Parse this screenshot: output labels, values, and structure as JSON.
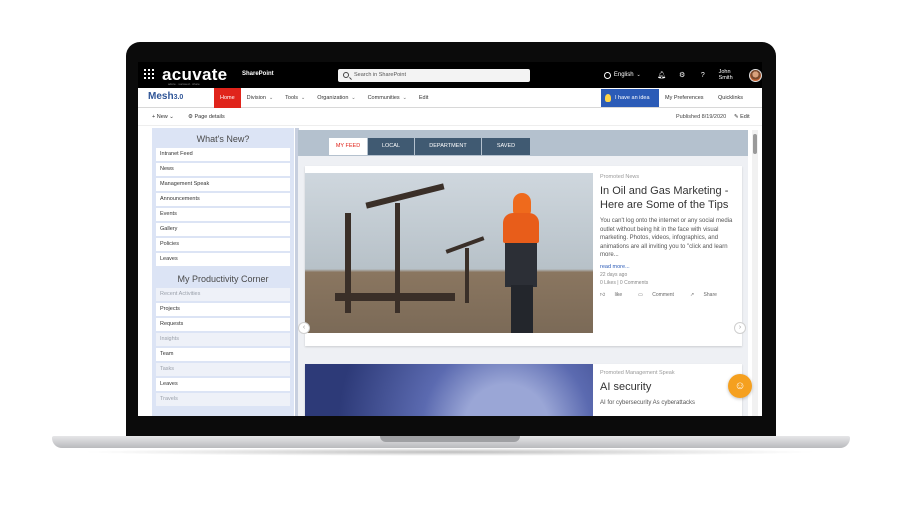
{
  "suitebar": {
    "logo": "acuvate",
    "logo_tag": "adore · succeed · share",
    "app_name": "SharePoint",
    "search_placeholder": "Search in SharePoint",
    "language": "English",
    "user_name": "John Smith"
  },
  "nav": {
    "logo": "Mesh",
    "logo_version": "3.0",
    "items": [
      {
        "label": "Home"
      },
      {
        "label": "Division"
      },
      {
        "label": "Tools"
      },
      {
        "label": "Organization"
      },
      {
        "label": "Communities"
      },
      {
        "label": "Edit"
      }
    ],
    "idea_button": "I have an idea",
    "preferences": "My Preferences",
    "quicklinks": "Quicklinks"
  },
  "commandbar": {
    "new": "New",
    "page_details": "Page details",
    "published": "Published 8/19/2020",
    "edit": "Edit"
  },
  "leftrail": {
    "whats_new_title": "What's New?",
    "whats_new_items": [
      "Intranet Feed",
      "News",
      "Management Speak",
      "Announcements",
      "Events",
      "Gallery",
      "Policies",
      "Leaves"
    ],
    "productivity_title": "My Productivity Corner",
    "productivity_items": [
      {
        "label": "Recent Activities",
        "muted": true
      },
      {
        "label": "Projects",
        "muted": false
      },
      {
        "label": "Requests",
        "muted": false
      },
      {
        "label": "Insights",
        "muted": true
      },
      {
        "label": "Team",
        "muted": false
      },
      {
        "label": "Tasks",
        "muted": true
      },
      {
        "label": "Leaves",
        "muted": false
      },
      {
        "label": "Travels",
        "muted": true
      }
    ]
  },
  "feed": {
    "tabs": [
      "MY FEED",
      "LOCAL",
      "DEPARTMENT",
      "SAVED"
    ],
    "card1": {
      "category": "Promoted News",
      "headline": "In Oil and Gas Marketing - Here are Some of the Tips",
      "excerpt": "You can't log onto the internet or any social media outlet without being hit in the face with visual marketing. Photos, videos, infographics, and animations are all inviting you to \"click and learn more...",
      "read_more": "read more...",
      "date": "22 days ago",
      "counts": "0 Likes | 0 Comments",
      "like": "like",
      "comment": "Comment",
      "share": "Share"
    },
    "card2": {
      "category": "Promoted Management Speak",
      "headline": "AI security",
      "excerpt": "AI for cybersecurity As cyberattacks"
    }
  },
  "colors": {
    "accent": "#e0241b",
    "brand_blue": "#2b5bb7",
    "rail_bg": "#dce4f5",
    "tab_bg": "#405a72",
    "fab": "#f5a01f"
  }
}
